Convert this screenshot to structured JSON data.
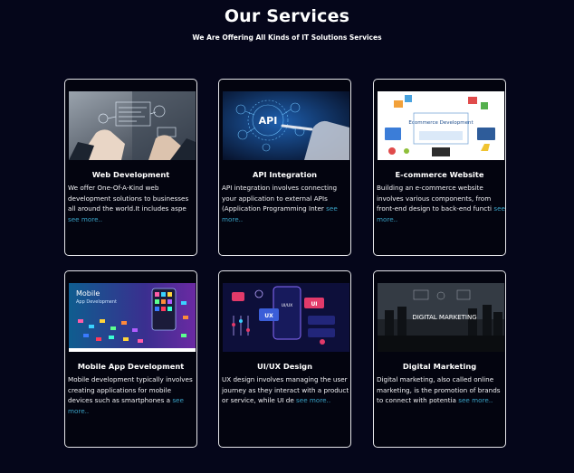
{
  "header": {
    "title": "Our Services",
    "subtitle": "We Are Offering All Kinds of IT Solutions Services"
  },
  "colors": {
    "background": "#05061a",
    "link": "#3aa3c7",
    "card_border": "#e6e6ea"
  },
  "cards": [
    {
      "title": "Web Development",
      "text": "We offer One-Of-A-Kind web development solutions to businesses all around the world.It includes aspe",
      "more": "see more..",
      "image_icon": "web-development-image"
    },
    {
      "title": "API Integration",
      "text": "API integration involves connecting your application to external APIs (Application Programming Inter",
      "more": "see more..",
      "image_icon": "api-integration-image",
      "image_text": "API"
    },
    {
      "title": "E-commerce Website",
      "text": "Building an e-commerce website involves various components, from front-end design to back-end functi",
      "more": "see more..",
      "image_icon": "ecommerce-image",
      "image_text": "Ecommerce Development"
    },
    {
      "title": "Mobile App Development",
      "text": "Mobile development typically involves creating applications for mobile devices such as smartphones a",
      "more": "see more..",
      "image_icon": "mobile-app-image",
      "image_text": "Mobile App Development"
    },
    {
      "title": "UI/UX Design",
      "text": "UX design involves managing the user journey as they interact with a product or service, while UI de",
      "more": "see more..",
      "image_icon": "ui-ux-image",
      "image_text": [
        "UX",
        "UI/UX",
        "UI"
      ]
    },
    {
      "title": "Digital Marketing",
      "text": "Digital marketing, also called online marketing, is the promotion of brands to connect with potentia",
      "more": "see more..",
      "image_icon": "digital-marketing-image",
      "image_text": "DIGITAL MARKETING"
    }
  ]
}
